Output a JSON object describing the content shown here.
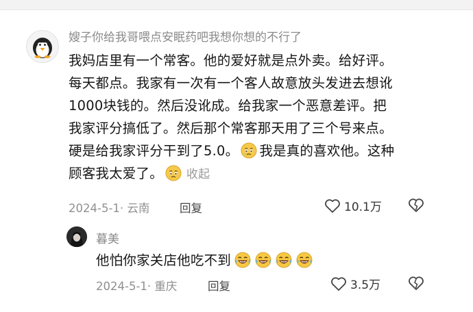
{
  "comments": [
    {
      "username": "嫂子你给我哥喂点安眠药吧我想你想的不行了",
      "avatar_icon": "penguin-avatar-icon",
      "lines": [
        "我妈店里有一个常客。他的爱好就是点外卖。给好评。",
        "每天都点。我家有一次有一个客人故意放头发进去想讹",
        "1000块钱的。然后没讹成。给我家一个恶意差评。把",
        "我家评分搞低了。然后那个常客那天用了三个号来点。",
        "硬是给我家评分干到了5.0。",
        "我是真的喜欢他。这种",
        "顾客我太爱了。"
      ],
      "emoji_icon": "teary-face-icon",
      "collapse_label": "收起",
      "date_location": "2024-5-1· 云南",
      "reply_label": "回复",
      "like_count": "10.1万"
    },
    {
      "username": "暮美",
      "avatar_icon": "dark-portrait-avatar-icon",
      "text": "他怕你家关店他吃不到",
      "emoji_icon": "laughing-crying-face-icon",
      "emoji_count": 4,
      "date_location": "2024-5-1· 重庆",
      "reply_label": "回复",
      "like_count": "3.5万"
    }
  ],
  "colors": {
    "meta_gray": "#8f8f8f",
    "username_gray": "#8a8a8a",
    "text": "#161616"
  }
}
